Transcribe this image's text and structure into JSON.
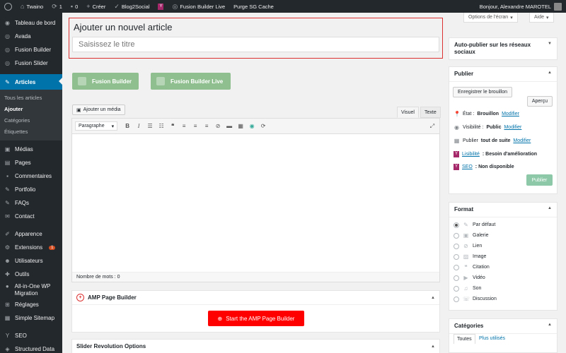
{
  "adminbar": {
    "site_name": "Twaino",
    "updates_count": "1",
    "comments_count": "0",
    "new_label": "Créer",
    "blog2social": "Blog2Social",
    "fusion_live": "Fusion Builder Live",
    "purge": "Purge SG Cache",
    "greeting": "Bonjour, Alexandre MAROTEL"
  },
  "sidebar": {
    "items": [
      {
        "label": "Tableau de bord",
        "icon": "dashboard-icon"
      },
      {
        "label": "Avada",
        "icon": "avada-icon"
      },
      {
        "label": "Fusion Builder",
        "icon": "fusion-builder-icon"
      },
      {
        "label": "Fusion Slider",
        "icon": "fusion-slider-icon"
      },
      {
        "label": "Articles",
        "icon": "pin-icon"
      },
      {
        "label": "Médias",
        "icon": "media-icon"
      },
      {
        "label": "Pages",
        "icon": "pages-icon"
      },
      {
        "label": "Commentaires",
        "icon": "comments-icon"
      },
      {
        "label": "Portfolio",
        "icon": "portfolio-icon"
      },
      {
        "label": "FAQs",
        "icon": "faq-icon"
      },
      {
        "label": "Contact",
        "icon": "contact-icon"
      },
      {
        "label": "Apparence",
        "icon": "appearance-icon"
      },
      {
        "label": "Extensions",
        "icon": "plugins-icon",
        "badge": "1"
      },
      {
        "label": "Utilisateurs",
        "icon": "users-icon"
      },
      {
        "label": "Outils",
        "icon": "tools-icon"
      },
      {
        "label": "All-in-One WP Migration",
        "icon": "migration-icon"
      },
      {
        "label": "Réglages",
        "icon": "settings-icon"
      },
      {
        "label": "Simple Sitemap",
        "icon": "sitemap-icon"
      },
      {
        "label": "SEO",
        "icon": "yoast-icon"
      },
      {
        "label": "Structured Data",
        "icon": "structured-data-icon"
      }
    ],
    "submenu": [
      "Tous les articles",
      "Ajouter",
      "Catégories",
      "Étiquettes"
    ]
  },
  "screen_options": {
    "options": "Options de l'écran",
    "help": "Aide"
  },
  "page_title": "Ajouter un nouvel article",
  "title_placeholder": "Saisissez le titre",
  "fusion": {
    "builder": "Fusion Builder",
    "builder_live": "Fusion Builder Live"
  },
  "editor": {
    "add_media": "Ajouter un média",
    "tab_visual": "Visuel",
    "tab_text": "Texte",
    "format_select": "Paragraphe",
    "word_count": "Nombre de mots : 0"
  },
  "amp": {
    "title": "AMP Page Builder",
    "button": "Start the AMP Page Builder"
  },
  "slider_rev": {
    "title": "Slider Revolution Options"
  },
  "right": {
    "auto_publish": "Auto-publier sur les réseaux sociaux",
    "publish_title": "Publier",
    "save_draft": "Enregistrer le brouillon",
    "preview": "Aperçu",
    "status_label": "État : ",
    "status_value": "Brouillon",
    "visibility_label": "Visibilité : ",
    "visibility_value": "Public",
    "publish_label": "Publier ",
    "publish_value": "tout de suite",
    "modify": "Modifier",
    "readability_link": "Lisibilité",
    "readability_value": " : Besoin d'amélioration",
    "seo_link": "SEO",
    "seo_value": " : Non disponible",
    "publish_button": "Publier",
    "format_title": "Format",
    "formats": [
      {
        "label": "Par défaut",
        "icon": "pin-icon",
        "checked": true
      },
      {
        "label": "Galerie",
        "icon": "gallery-icon"
      },
      {
        "label": "Lien",
        "icon": "link-icon"
      },
      {
        "label": "Image",
        "icon": "image-icon"
      },
      {
        "label": "Citation",
        "icon": "quote-icon"
      },
      {
        "label": "Vidéo",
        "icon": "video-icon"
      },
      {
        "label": "Son",
        "icon": "audio-icon"
      },
      {
        "label": "Discussion",
        "icon": "chat-icon"
      }
    ],
    "categories_title": "Catégories",
    "cat_tab_all": "Toutes",
    "cat_tab_popular": "Plus utilisés"
  },
  "colors": {
    "accent": "#0073aa",
    "title_border": "#dc3232",
    "fusion_green": "#8fbf8f",
    "amp_red": "#ff0000"
  }
}
